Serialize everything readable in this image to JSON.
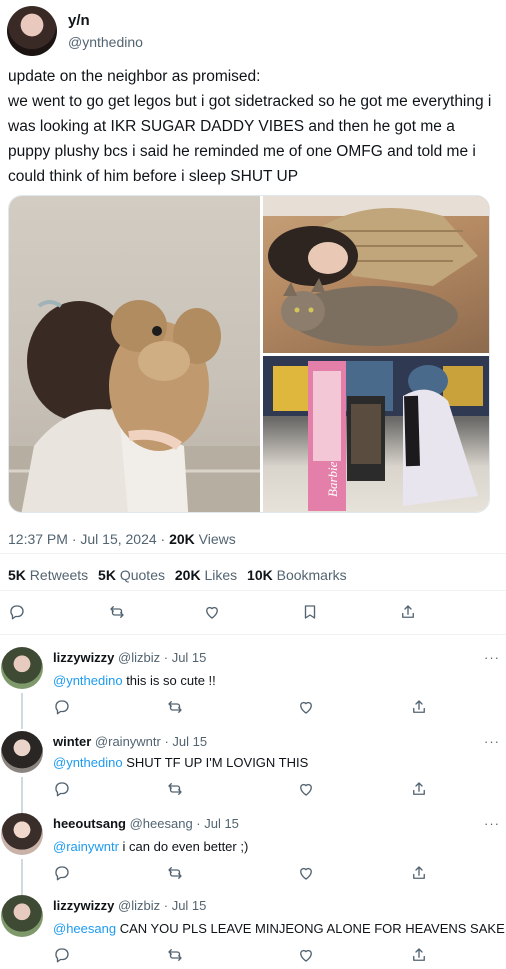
{
  "tweet": {
    "author": {
      "name": "y/n",
      "handle": "@ynthedino"
    },
    "text": "update on the neighbor as promised:\nwe went to go get legos but i got sidetracked so he got me everything i was looking at IKR SUGAR DADDY VIBES and then he got me a puppy plushy bcs i said he reminded me of one OMFG and told me i could think of him before i sleep SHUT UP",
    "time": "12:37 PM · Jul 15, 2024 · ",
    "views_count": "20K",
    "views_label": " Views",
    "stats": [
      {
        "count": "5K",
        "label": "Retweets"
      },
      {
        "count": "5K",
        "label": "Quotes"
      },
      {
        "count": "20K",
        "label": "Likes"
      },
      {
        "count": "10K",
        "label": "Bookmarks"
      }
    ]
  },
  "replies": [
    {
      "name": "lizzywizzy",
      "meta": "@lizbiz · Jul 15",
      "mention": "@ynthedino",
      "text": " this is so cute !!"
    },
    {
      "name": "winter",
      "meta": "@rainywntr · Jul 15",
      "mention": "@ynthedino",
      "text": " SHUT TF UP I'M LOVIGN THIS"
    },
    {
      "name": "heeoutsang",
      "meta": "@heesang · Jul 15",
      "mention": "@rainywntr",
      "text": " i can do even better ;)"
    },
    {
      "name": "lizzywizzy",
      "meta": "@lizbiz · Jul 15",
      "mention": "@heesang",
      "text": " CAN YOU PLS LEAVE MINJEONG ALONE FOR HEAVENS SAKE"
    }
  ],
  "more_label": "···",
  "photo_barbie_label": "Barbie",
  "icons": [
    "reply-icon",
    "retweet-icon",
    "like-icon",
    "bookmark-icon",
    "share-icon",
    "more-icon"
  ],
  "colors": {
    "link": "#1d9bf0",
    "muted": "#536471",
    "text": "#0f1419"
  }
}
